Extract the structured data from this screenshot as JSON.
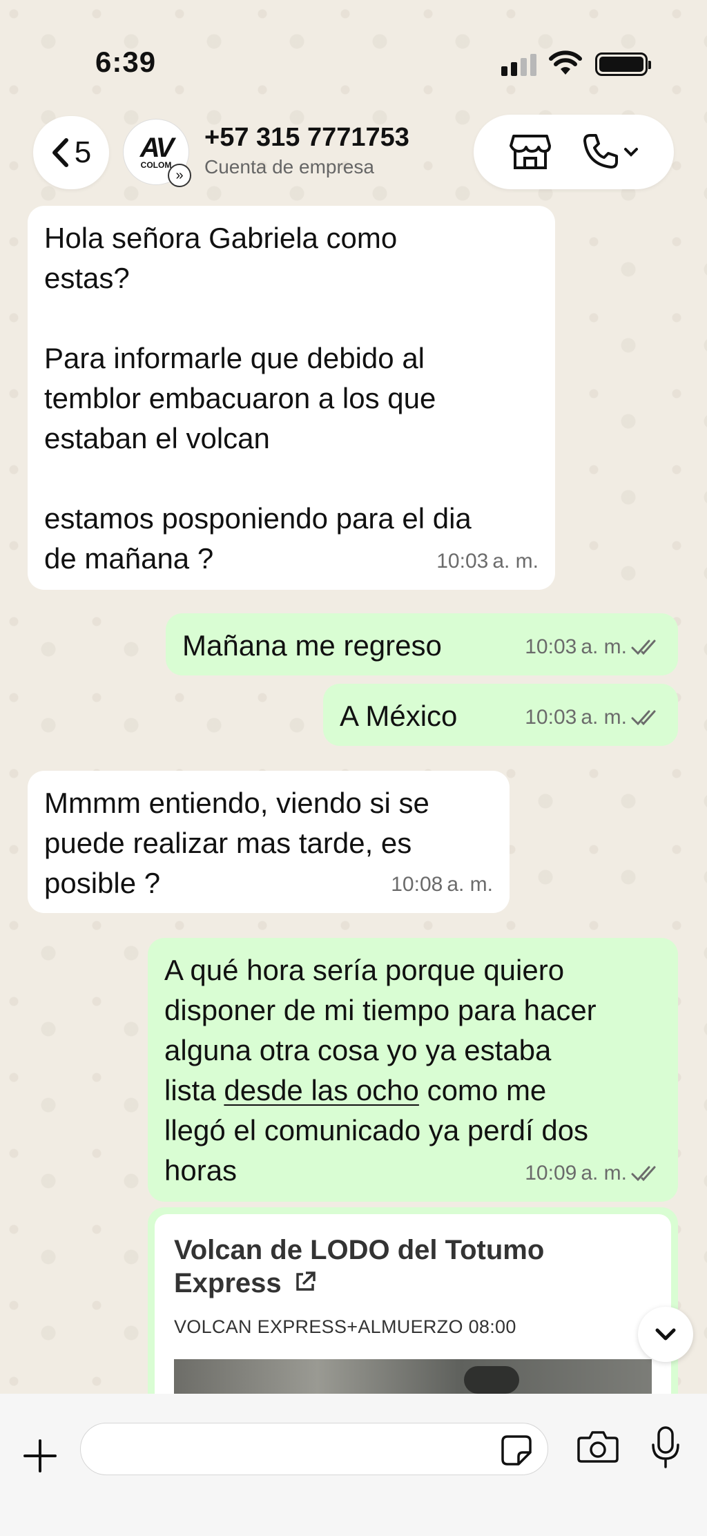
{
  "status_bar": {
    "time": "6:39"
  },
  "header": {
    "back_count": "5",
    "avatar_logo": "AV",
    "avatar_sub": "COLOM",
    "contact_name": "+57 315 7771753",
    "contact_sub": "Cuenta de empresa",
    "icons": [
      "back-chevron-icon",
      "shop-icon",
      "phone-icon",
      "chevron-down-icon"
    ]
  },
  "messages": [
    {
      "direction": "in",
      "text": "Hola señora Gabriela como\nestas?\n\nPara informarle que debido al\ntemblor embacuaron a los que\nestaban el volcan\n\nestamos posponiendo para el dia\nde mañana ?",
      "time": "10:03",
      "ampm": "a. m."
    },
    {
      "direction": "out",
      "text": "Mañana me regreso",
      "time": "10:03",
      "ampm": "a. m.",
      "status": "read"
    },
    {
      "direction": "out",
      "text": "A México",
      "time": "10:03",
      "ampm": "a. m.",
      "status": "read"
    },
    {
      "direction": "in",
      "text": "Mmmm entiendo, viendo si se\npuede realizar mas tarde, es\nposible ?",
      "time": "10:08",
      "ampm": "a. m."
    },
    {
      "direction": "out",
      "text_a": "A qué hora sería porque quiero\ndisponer de mi tiempo para hacer\nalguna otra cosa yo ya estaba\nlista ",
      "text_link1": "desde las ocho",
      "text_b": " como me\n",
      "text_link2": "llegó el comunicado",
      "text_c": " ya perdí dos\nhoras",
      "time": "10:09",
      "ampm": "a. m.",
      "status": "read"
    }
  ],
  "link_card": {
    "title": "Volcan de LODO del Totumo Express",
    "subtitle": "VOLCAN EXPRESS+ALMUERZO 08:00"
  },
  "input": {
    "placeholder": ""
  },
  "colors": {
    "incoming": "#ffffff",
    "outgoing": "#d9fdd3",
    "background": "#efeae2"
  }
}
